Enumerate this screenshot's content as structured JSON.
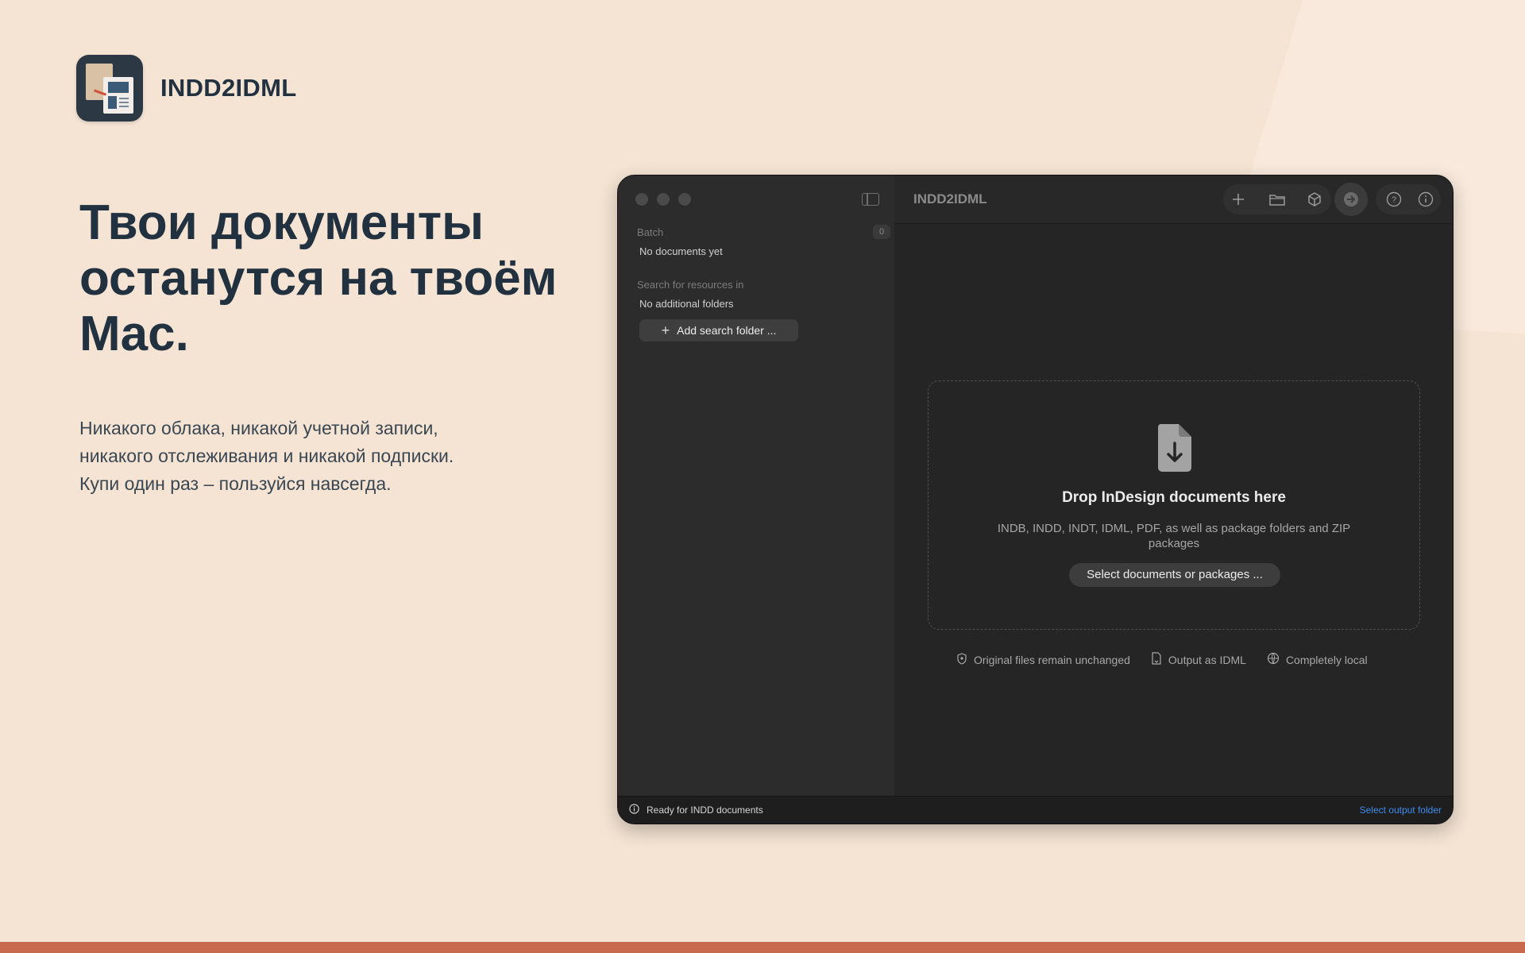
{
  "brand": {
    "name": "INDD2IDML"
  },
  "hero": {
    "headline": "Твои документы останутся на твоём Mac.",
    "subtext_lines": [
      "Никакого облака, никакой учетной записи,",
      "никакого отслеживания и никакой подписки.",
      "Купи один раз – пользуйся навсегда."
    ]
  },
  "window": {
    "title": "INDD2IDML",
    "sidebar": {
      "batch_title": "Batch",
      "batch_count": "0",
      "batch_empty": "No documents yet",
      "search_title": "Search for resources in",
      "search_empty": "No additional folders",
      "add_folder_label": "Add search folder ..."
    },
    "toolbar_icons": [
      "plus-icon",
      "folder-icon",
      "package-icon",
      "convert-arrow-icon",
      "help-icon",
      "info-icon"
    ],
    "dropzone": {
      "title": "Drop InDesign documents here",
      "subtitle": "INDB, INDD, INDT, IDML, PDF, as well as package folders and ZIP packages",
      "button_label": "Select documents or packages ..."
    },
    "features": [
      {
        "icon": "shield-icon",
        "label": "Original files remain unchanged"
      },
      {
        "icon": "document-icon",
        "label": "Output as IDML"
      },
      {
        "icon": "globe-icon",
        "label": "Completely local"
      }
    ],
    "status": {
      "text": "Ready for INDD documents",
      "action": "Select output folder"
    }
  },
  "colors": {
    "background": "#f5e4d3",
    "heading": "#22313f",
    "accent_bar": "#c8694e",
    "link": "#3d8cf0"
  }
}
